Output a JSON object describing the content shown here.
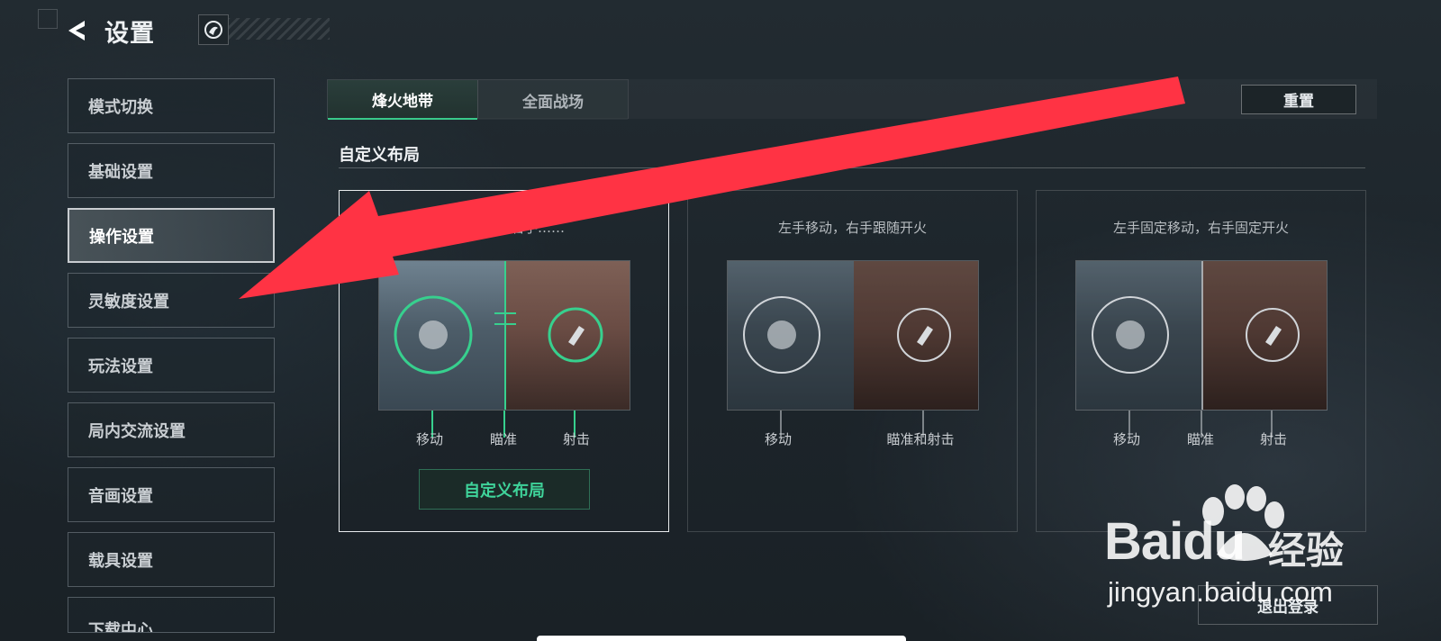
{
  "header": {
    "title": "设置"
  },
  "sidebar": {
    "items": [
      {
        "label": "模式切换"
      },
      {
        "label": "基础设置"
      },
      {
        "label": "操作设置"
      },
      {
        "label": "灵敏度设置"
      },
      {
        "label": "玩法设置"
      },
      {
        "label": "局内交流设置"
      },
      {
        "label": "音画设置"
      },
      {
        "label": "载具设置"
      },
      {
        "label": "下载中心"
      }
    ],
    "active_index": 2
  },
  "tabs": [
    {
      "label": "烽火地带",
      "active": true
    },
    {
      "label": "全面战场",
      "active": false
    }
  ],
  "toolbar": {
    "reset_label": "重置"
  },
  "section": {
    "title": "自定义布局"
  },
  "cards": [
    {
      "desc": "左手移动，右手……",
      "selected": true,
      "labels": [
        "移动",
        "瞄准",
        "射击"
      ],
      "button_label": "自定义布局"
    },
    {
      "desc": "左手移动，右手跟随开火",
      "selected": false,
      "labels": [
        "移动",
        "瞄准和射击"
      ]
    },
    {
      "desc": "左手固定移动，右手固定开火",
      "selected": false,
      "labels": [
        "移动",
        "瞄准",
        "射击"
      ]
    }
  ],
  "footer": {
    "logout_label": "退出登录"
  },
  "watermark": {
    "brand": "Baidu",
    "brand_cn": "经验",
    "url": "jingyan.baidu.com"
  },
  "colors": {
    "accent_green": "#3fd39a",
    "arrow_red": "#ff3344"
  }
}
